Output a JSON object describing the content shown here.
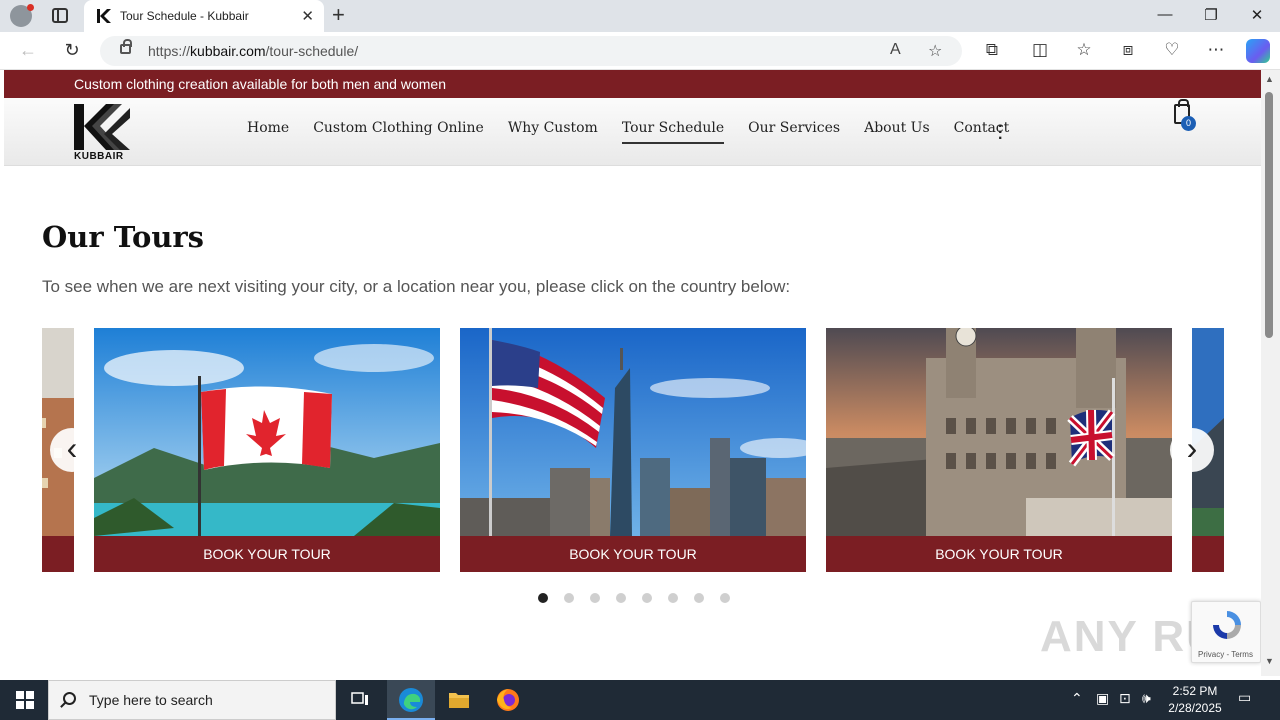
{
  "browser": {
    "tab_title": "Tour Schedule - Kubbair",
    "url_prefix": "https://",
    "url_domain": "kubbair.com",
    "url_path": "/tour-schedule/"
  },
  "site": {
    "promo_text": "Custom clothing creation available for both men and women",
    "logo_text": "KUBBAIR",
    "nav": [
      {
        "label": "Home"
      },
      {
        "label": "Custom Clothing Online"
      },
      {
        "label": "Why Custom"
      },
      {
        "label": "Tour Schedule",
        "active": true
      },
      {
        "label": "Our Services"
      },
      {
        "label": "About Us"
      },
      {
        "label": "Contact"
      }
    ],
    "cart_count": "0"
  },
  "main": {
    "title": "Our Tours",
    "subtitle": "To see when we are next visiting your city, or a location near you, please click on the country below:",
    "tours": [
      {
        "scene": "canada-flag",
        "button": "BOOK YOUR TOUR"
      },
      {
        "scene": "usa-flag-newyork",
        "button": "BOOK YOUR TOUR"
      },
      {
        "scene": "uk-flag-liverpool",
        "button": "BOOK YOUR TOUR"
      }
    ],
    "slide_count": 8,
    "active_slide": 0
  },
  "recaptcha": {
    "links": "Privacy - Terms"
  },
  "watermark": "ANY RUN",
  "taskbar": {
    "search_placeholder": "Type here to search",
    "time": "2:52 PM",
    "date": "2/28/2025"
  },
  "colors": {
    "brand": "#7b1e23",
    "taskbar": "#1f2a36"
  }
}
